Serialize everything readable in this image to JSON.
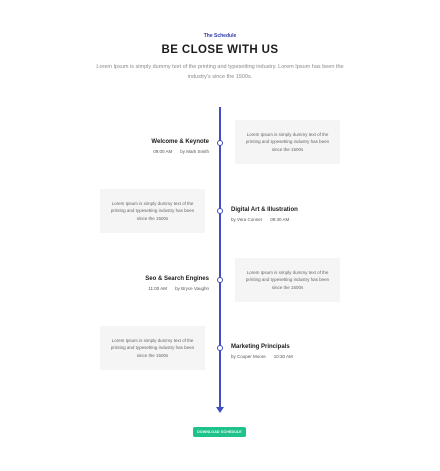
{
  "header": {
    "eyebrow": "The Schedule",
    "title": "BE CLOSE WITH US",
    "subtitle": "Lorem Ipsum is simply dummy text of the printing and typesetting industry. Lorem Ipsum has been the industry's since the 1500s."
  },
  "events": [
    {
      "title": "Welcome & Keynote",
      "time": "09:00 AM",
      "speaker": "by Mark Smith",
      "description": "Lorem Ipsum is simply dummy text of the printing and typesetting industry has been since the 1500s"
    },
    {
      "title": "Digital Art & Illustration",
      "time": "09:30 AM",
      "speaker": "by Vera Conner",
      "description": "Lorem Ipsum is simply dummy text of the printing and typesetting industry has been since the 1500s"
    },
    {
      "title": "Seo & Search Engines",
      "time": "11:00 AM",
      "speaker": "by Bryce Vaughn",
      "description": "Lorem Ipsum is simply dummy text of the printing and typesetting industry has been since the 1500s"
    },
    {
      "title": "Marketing Principals",
      "time": "10:30 AM",
      "speaker": "by Cooper Moore",
      "description": "Lorem Ipsum is simply dummy text of the printing and typesetting industry has been since the 1500s"
    }
  ],
  "download_button": "DOWNLOAD SCHEDULE",
  "colors": {
    "accent": "#3f4fbf",
    "button": "#1ec28b",
    "box_background": "#f5f5f5"
  }
}
